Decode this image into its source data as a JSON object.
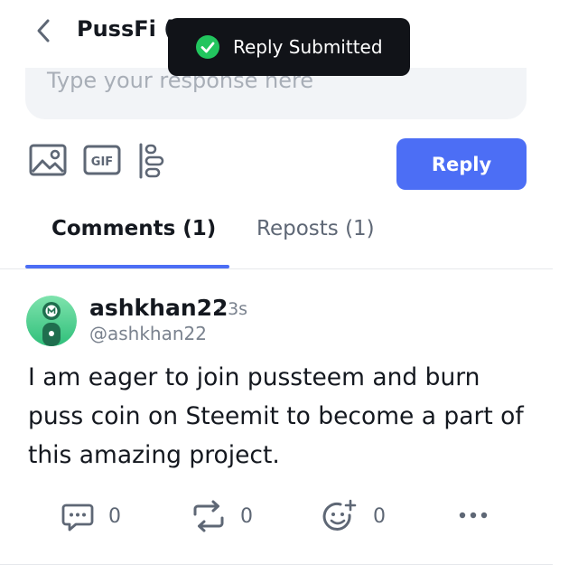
{
  "header": {
    "title": "PussFi ($"
  },
  "toast": {
    "message": "Reply Submitted"
  },
  "composer": {
    "placeholder": "Type your response here",
    "reply_label": "Reply"
  },
  "tabs": [
    {
      "label": "Comments (1)",
      "active": true
    },
    {
      "label": "Reposts (1)",
      "active": false
    }
  ],
  "comment": {
    "author": "ashkhan22",
    "time": "· 3s",
    "handle": "@ashkhan22",
    "body": "I am eager to join pussteem and burn puss coin on Steemit to become a part of this amazing project.",
    "actions": {
      "reply_count": "0",
      "repost_count": "0",
      "react_count": "0"
    }
  },
  "colors": {
    "accent": "#4c6ef5",
    "toast_bg": "#111318",
    "success": "#22c55e",
    "muted": "#7a828e"
  },
  "icons": [
    "back-arrow-icon",
    "check-circle-icon",
    "image-icon",
    "gif-icon",
    "poll-icon",
    "comment-icon",
    "repost-icon",
    "add-reaction-icon",
    "more-icon"
  ]
}
